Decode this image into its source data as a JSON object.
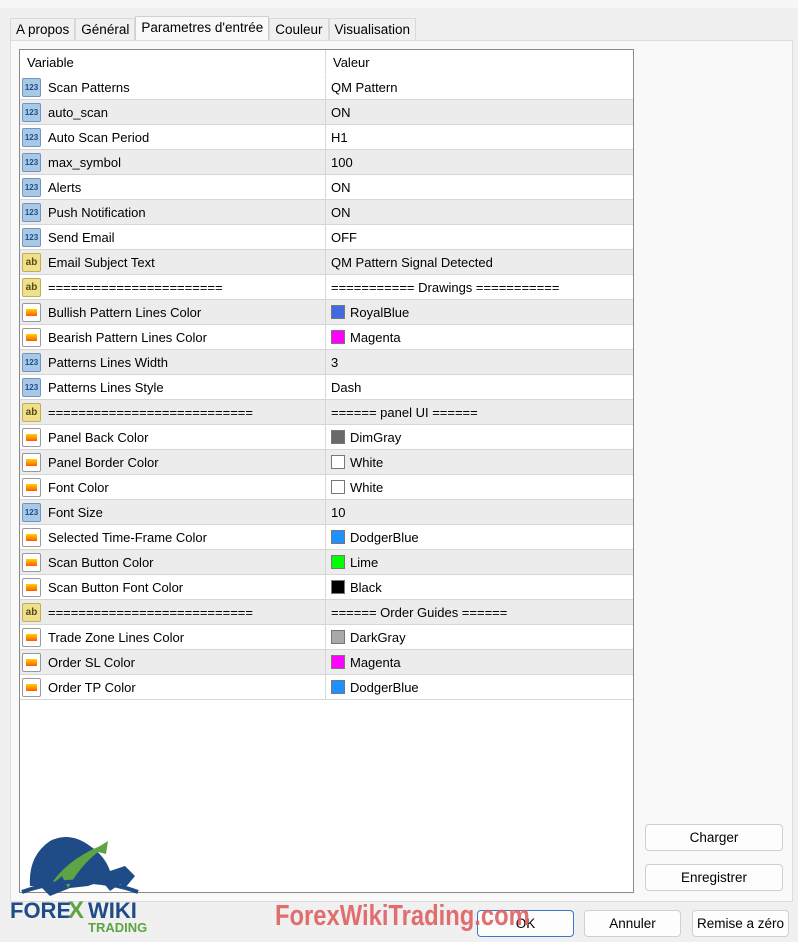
{
  "tabs": [
    "A propos",
    "Général",
    "Parametres d'entrée",
    "Couleur",
    "Visualisation"
  ],
  "active_tab": 2,
  "table": {
    "headers": [
      "Variable",
      "Valeur"
    ],
    "rows": [
      {
        "type": "num",
        "variable": "Scan Patterns",
        "value": "QM Pattern"
      },
      {
        "type": "num",
        "variable": "auto_scan",
        "value": "ON"
      },
      {
        "type": "num",
        "variable": "Auto Scan Period",
        "value": "H1"
      },
      {
        "type": "num",
        "variable": "max_symbol",
        "value": "100"
      },
      {
        "type": "num",
        "variable": "Alerts",
        "value": "ON"
      },
      {
        "type": "num",
        "variable": "Push Notification",
        "value": "ON"
      },
      {
        "type": "num",
        "variable": "Send Email",
        "value": "OFF"
      },
      {
        "type": "str",
        "variable": "Email Subject Text",
        "value": "QM Pattern Signal Detected"
      },
      {
        "type": "str",
        "variable": "=======================",
        "value": "=========== Drawings ==========="
      },
      {
        "type": "col",
        "variable": "Bullish Pattern Lines Color",
        "value": "RoyalBlue",
        "swatch": "#4169e1"
      },
      {
        "type": "col",
        "variable": "Bearish Pattern Lines Color",
        "value": "Magenta",
        "swatch": "#ff00ff"
      },
      {
        "type": "num",
        "variable": "Patterns Lines Width",
        "value": "3"
      },
      {
        "type": "num",
        "variable": "Patterns Lines Style",
        "value": "Dash"
      },
      {
        "type": "str",
        "variable": "===========================",
        "value": "====== panel UI ======"
      },
      {
        "type": "col",
        "variable": "Panel Back Color",
        "value": "DimGray",
        "swatch": "#696969"
      },
      {
        "type": "col",
        "variable": "Panel Border Color",
        "value": "White",
        "swatch": "#ffffff"
      },
      {
        "type": "col",
        "variable": "Font Color",
        "value": "White",
        "swatch": "#ffffff"
      },
      {
        "type": "num",
        "variable": "Font Size",
        "value": "10"
      },
      {
        "type": "col",
        "variable": "Selected Time-Frame Color",
        "value": "DodgerBlue",
        "swatch": "#1e90ff"
      },
      {
        "type": "col",
        "variable": "Scan Button Color",
        "value": "Lime",
        "swatch": "#00ff00"
      },
      {
        "type": "col",
        "variable": "Scan Button Font Color",
        "value": "Black",
        "swatch": "#000000"
      },
      {
        "type": "str",
        "variable": "===========================",
        "value": "====== Order Guides ======"
      },
      {
        "type": "col",
        "variable": "Trade Zone Lines Color",
        "value": "DarkGray",
        "swatch": "#a9a9a9"
      },
      {
        "type": "col",
        "variable": "Order SL Color",
        "value": "Magenta",
        "swatch": "#ff00ff"
      },
      {
        "type": "col",
        "variable": "Order TP Color",
        "value": "DodgerBlue",
        "swatch": "#1e90ff"
      }
    ]
  },
  "icon_labels": {
    "num": "123",
    "str": "ab"
  },
  "buttons": {
    "load": "Charger",
    "save": "Enregistrer",
    "ok": "OK",
    "cancel": "Annuler",
    "reset": "Remise a zéro"
  },
  "watermark": "ForexWikiTrading.com",
  "logo": {
    "line1": "FOREX WIKI",
    "line2": "TRADING"
  }
}
